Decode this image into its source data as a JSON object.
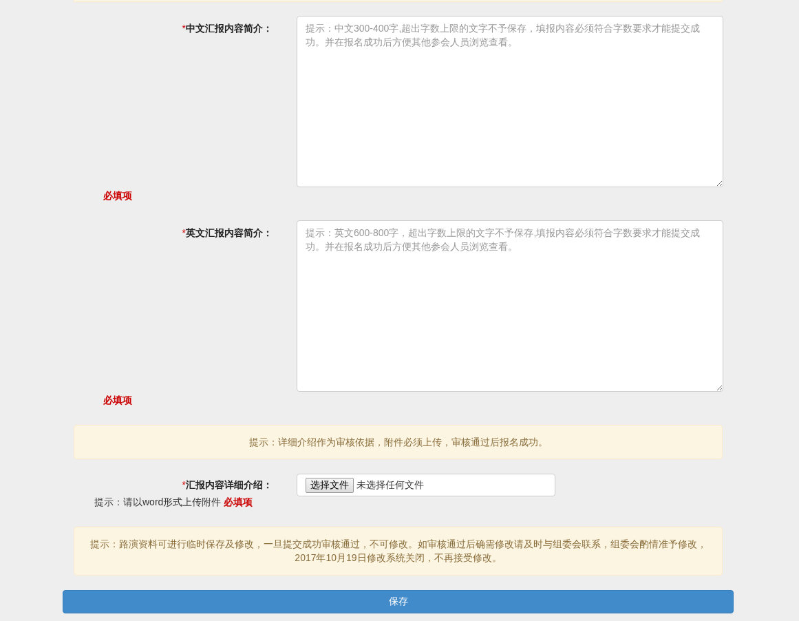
{
  "fields": [
    {
      "required_mark": "*",
      "label": "中文汇报内容简介：",
      "placeholder": "提示：中文300-400字,超出字数上限的文字不予保存，填报内容必须符合字数要求才能提交成功。并在报名成功后方便其他参会人员浏览查看。",
      "required_note": "必填项"
    },
    {
      "required_mark": "*",
      "label": "英文汇报内容简介：",
      "placeholder": "提示：英文600-800字，超出字数上限的文字不予保存,填报内容必须符合字数要求才能提交成功。并在报名成功后方便其他参会人员浏览查看。",
      "required_note": "必填项"
    }
  ],
  "notice_1": "提示：详细介绍作为审核依据，附件必须上传，审核通过后报名成功。",
  "upload": {
    "required_mark": "*",
    "label": "汇报内容详细介绍：",
    "hint": "提示：请以word形式上传附件",
    "required_note": "必填项",
    "button": "选择文件",
    "status": "未选择任何文件"
  },
  "notice_2": "提示：路演资料可进行临时保存及修改，一旦提交成功审核通过，不可修改。如审核通过后确需修改请及时与组委会联系，组委会酌情准予修改，2017年10月19日修改系统关闭，不再接受修改。",
  "save_button": "保存"
}
